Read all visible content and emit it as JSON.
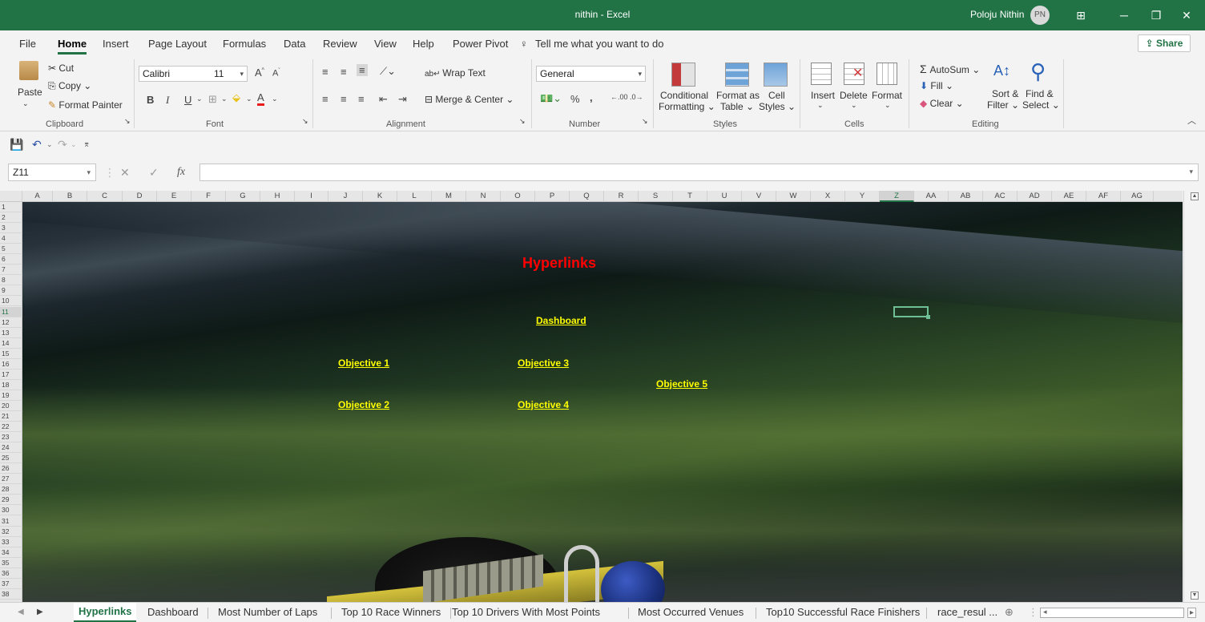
{
  "window": {
    "title": "nithin  -  Excel",
    "user_name": "Poloju Nithin",
    "user_initials": "PN"
  },
  "menu": {
    "tabs": [
      "File",
      "Home",
      "Insert",
      "Page Layout",
      "Formulas",
      "Data",
      "Review",
      "View",
      "Help",
      "Power Pivot"
    ],
    "active_tab": "Home",
    "tell_me": "Tell me what you want to do",
    "share": "Share"
  },
  "ribbon": {
    "clipboard": {
      "label": "Clipboard",
      "paste": "Paste",
      "cut": "Cut",
      "copy": "Copy",
      "format_painter": "Format Painter"
    },
    "font": {
      "label": "Font",
      "name": "Calibri",
      "size": "11",
      "bold": "B",
      "italic": "I",
      "underline": "U"
    },
    "alignment": {
      "label": "Alignment",
      "wrap_text": "Wrap Text",
      "merge_center": "Merge & Center"
    },
    "number": {
      "label": "Number",
      "format": "General",
      "percent": "%",
      "comma": ",",
      "inc_dec": ".00",
      "dec_dec": ".0"
    },
    "styles": {
      "label": "Styles",
      "conditional": "Conditional",
      "conditional2": "Formatting",
      "format_as": "Format as",
      "format_as2": "Table",
      "cell": "Cell",
      "cell2": "Styles"
    },
    "cells": {
      "label": "Cells",
      "insert": "Insert",
      "delete": "Delete",
      "format": "Format"
    },
    "editing": {
      "label": "Editing",
      "autosum": "AutoSum",
      "fill": "Fill",
      "clear": "Clear",
      "sort": "Sort &",
      "sort2": "Filter",
      "find": "Find &",
      "find2": "Select"
    }
  },
  "formula_bar": {
    "name_box": "Z11",
    "fx": "fx",
    "content": ""
  },
  "grid": {
    "columns": [
      "A",
      "B",
      "C",
      "D",
      "E",
      "F",
      "G",
      "H",
      "I",
      "J",
      "K",
      "L",
      "M",
      "N",
      "O",
      "P",
      "Q",
      "R",
      "S",
      "T",
      "U",
      "V",
      "W",
      "X",
      "Y",
      "Z",
      "AA",
      "AB",
      "AC",
      "AD",
      "AE",
      "AF",
      "AG"
    ],
    "selected_column": "Z",
    "rows": [
      "1",
      "2",
      "3",
      "4",
      "5",
      "6",
      "7",
      "8",
      "9",
      "10",
      "11",
      "12",
      "13",
      "14",
      "15",
      "16",
      "17",
      "18",
      "19",
      "20",
      "21",
      "22",
      "23",
      "24",
      "25",
      "26",
      "27",
      "28",
      "29",
      "30",
      "31",
      "32",
      "33",
      "34",
      "35",
      "36",
      "37",
      "38"
    ],
    "selected_row": "11"
  },
  "sheet": {
    "title": "Hyperlinks",
    "links": {
      "dashboard": "Dashboard",
      "obj1": "Objective 1",
      "obj2": "Objective 2",
      "obj3": "Objective 3",
      "obj4": "Objective 4",
      "obj5": "Objective 5"
    }
  },
  "sheet_tabs": {
    "tabs": [
      "Hyperlinks",
      "Dashboard",
      "Most Number of Laps",
      "Top 10 Race Winners",
      "Top 10 Drivers With Most Points",
      "Most Occurred Venues",
      "Top10 Successful Race Finishers",
      "race_resul ..."
    ],
    "active": "Hyperlinks"
  },
  "colors": {
    "excel_green": "#217346",
    "title_red": "#ff0000",
    "link_yellow": "#ffff00"
  }
}
